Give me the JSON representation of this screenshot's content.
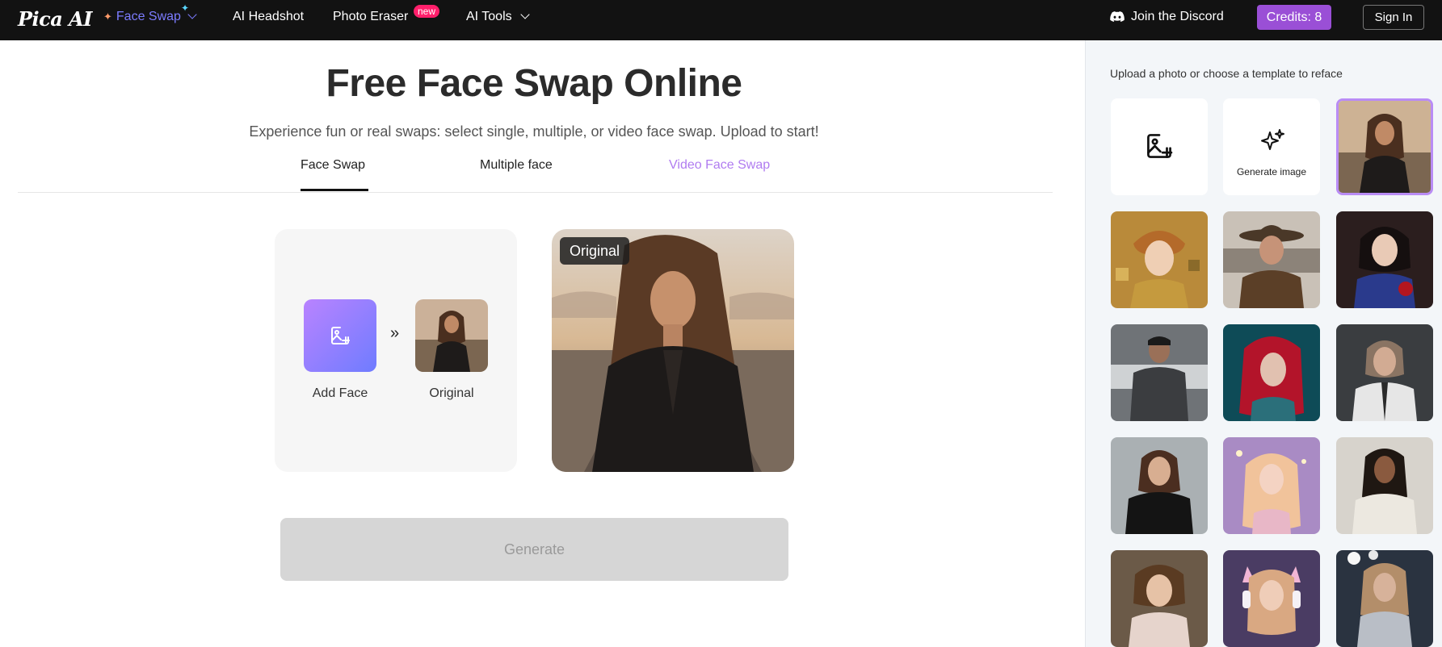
{
  "header": {
    "logo": "Pica AI",
    "nav": {
      "face_swap": "Face Swap",
      "ai_headshot": "AI Headshot",
      "photo_eraser": "Photo Eraser",
      "new_badge": "new",
      "ai_tools": "AI Tools"
    },
    "discord": "Join the Discord",
    "credits": "Credits: 8",
    "sign_in": "Sign In"
  },
  "main": {
    "title": "Free Face Swap Online",
    "subtitle": "Experience fun or real swaps: select single, multiple, or video face swap. Upload to start!",
    "tabs": {
      "face_swap": "Face Swap",
      "multiple_face": "Multiple face",
      "video_face_swap": "Video Face Swap"
    },
    "card": {
      "add_face_label": "Add Face",
      "original_label": "Original",
      "arrows": "»"
    },
    "preview_tag": "Original",
    "generate_label": "Generate"
  },
  "sidebar": {
    "hint": "Upload a photo or choose a template to reface",
    "generate_image_label": "Generate image"
  },
  "colors": {
    "accent": "#9a4fd6",
    "nav_active": "#7c7cff",
    "video_tab": "#b07cf0",
    "new_badge": "#ff1f6b",
    "selected_border": "#b98cf5",
    "generate_disabled": "#d6d6d6"
  }
}
